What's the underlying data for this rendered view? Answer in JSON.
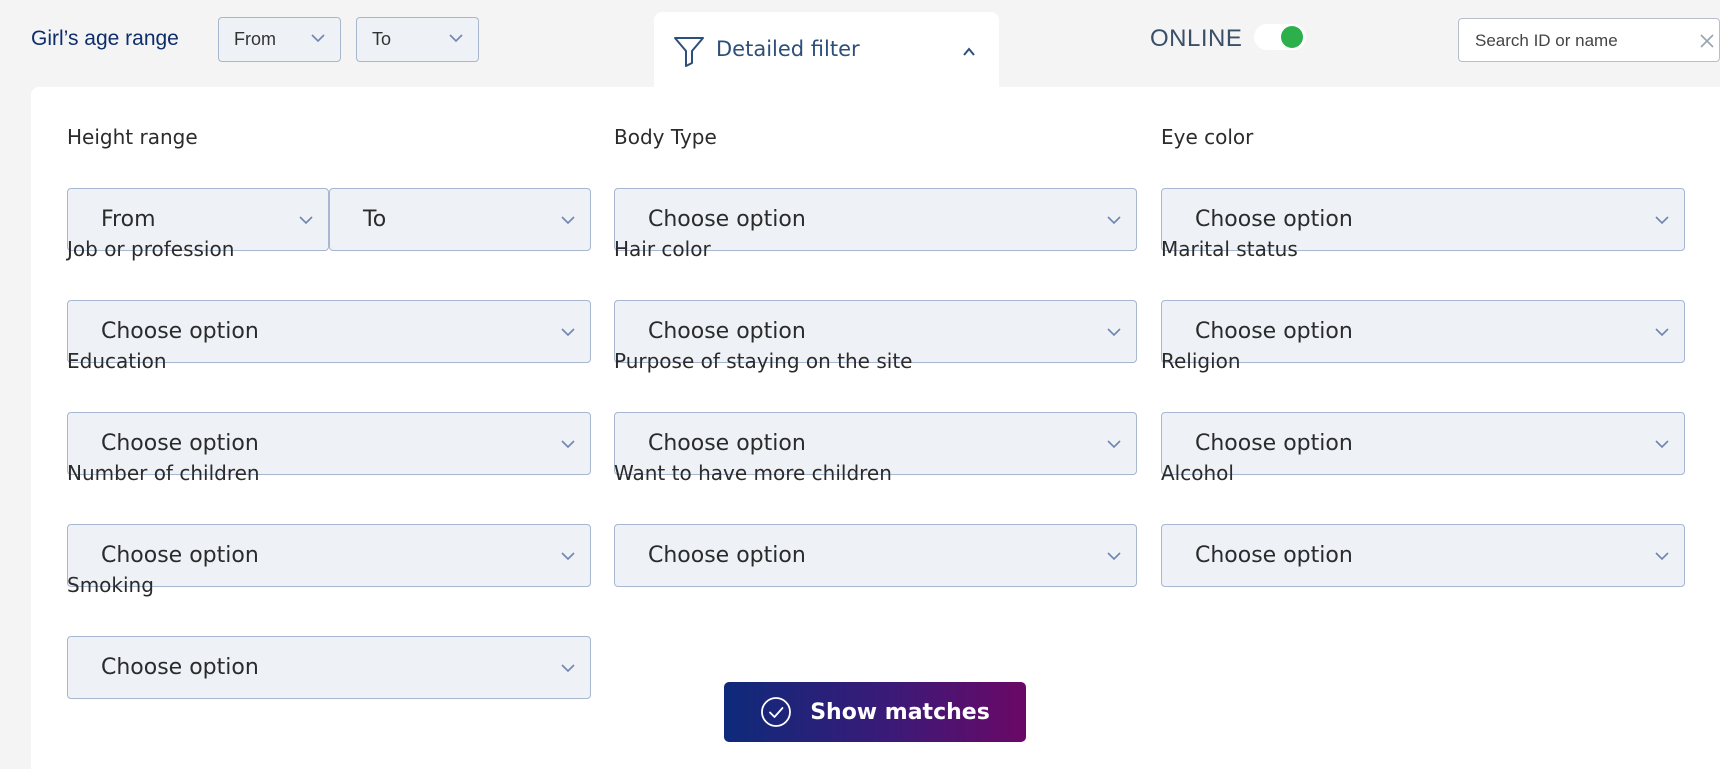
{
  "header": {
    "age_label": "Girl’s age range",
    "age_from": "From",
    "age_to": "To",
    "detailed_filter": "Detailed filter",
    "online_label": "ONLINE",
    "online_enabled": true,
    "search_placeholder": "Search ID or name"
  },
  "filters": {
    "height": {
      "label": "Height range",
      "from": "From",
      "to": "To"
    },
    "body_type": {
      "label": "Body Type",
      "value": "Choose option"
    },
    "eye_color": {
      "label": "Eye color",
      "value": "Choose option"
    },
    "job": {
      "label": "Job or profession",
      "value": "Choose option"
    },
    "hair_color": {
      "label": "Hair color",
      "value": "Choose option"
    },
    "marital_status": {
      "label": "Marital status",
      "value": "Choose option"
    },
    "education": {
      "label": "Education",
      "value": "Choose option"
    },
    "purpose": {
      "label": "Purpose of staying on the site",
      "value": "Choose option"
    },
    "religion": {
      "label": "Religion",
      "value": "Choose option"
    },
    "children": {
      "label": "Number of children",
      "value": "Choose option"
    },
    "more_children": {
      "label": "Want to have more children",
      "value": "Choose option"
    },
    "alcohol": {
      "label": "Alcohol",
      "value": "Choose option"
    },
    "smoking": {
      "label": "Smoking",
      "value": "Choose option"
    }
  },
  "actions": {
    "show_matches": "Show matches"
  },
  "colors": {
    "accent_navy": "#0e2d6b",
    "toggle_on": "#2bb04c",
    "button_gradient_start": "#0e2a7a",
    "button_gradient_end": "#6b0866"
  }
}
